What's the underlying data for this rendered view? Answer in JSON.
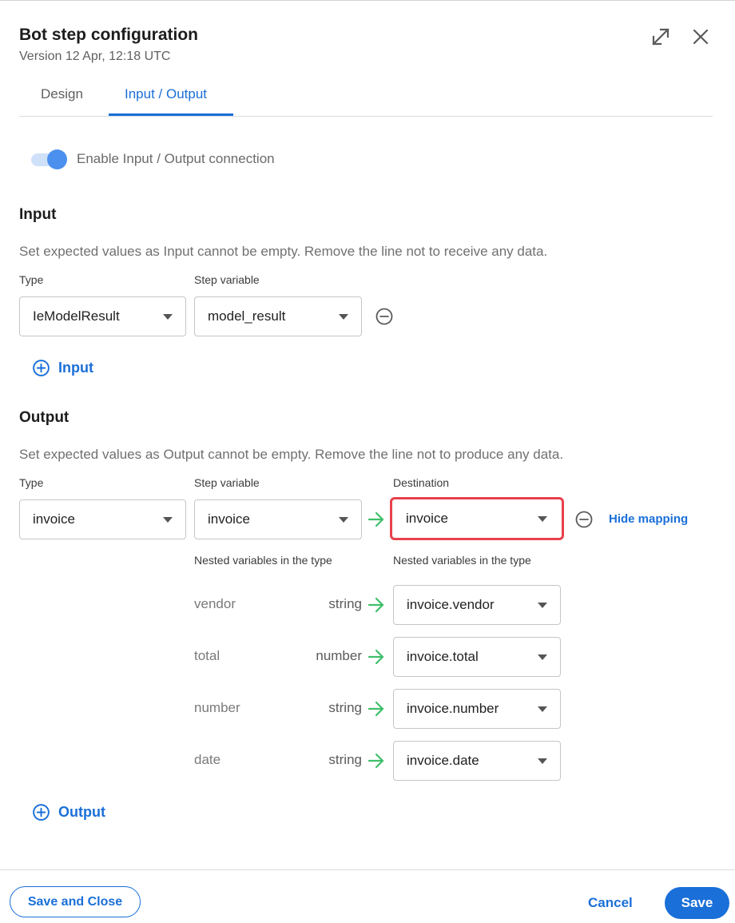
{
  "header": {
    "title": "Bot step configuration",
    "version": "Version 12 Apr, 12:18 UTC"
  },
  "tabs": [
    {
      "label": "Design",
      "active": false
    },
    {
      "label": "Input / Output",
      "active": true
    }
  ],
  "toggle": {
    "label": "Enable Input / Output connection",
    "enabled": true
  },
  "input": {
    "title": "Input",
    "description": "Set expected values as Input cannot be empty. Remove the line not to receive any data.",
    "type_label": "Type",
    "step_variable_label": "Step variable",
    "type_value": "IeModelResult",
    "step_variable_value": "model_result",
    "add_label": "Input"
  },
  "output": {
    "title": "Output",
    "description": "Set expected values as Output cannot be empty. Remove the line not to produce any data.",
    "type_label": "Type",
    "step_variable_label": "Step variable",
    "destination_label": "Destination",
    "type_value": "invoice",
    "step_variable_value": "invoice",
    "destination_value": "invoice",
    "hide_mapping_label": "Hide mapping",
    "nested_label_left": "Nested variables in the type",
    "nested_label_right": "Nested variables in the type",
    "nested": [
      {
        "name": "vendor",
        "type": "string",
        "destination": "invoice.vendor"
      },
      {
        "name": "total",
        "type": "number",
        "destination": "invoice.total"
      },
      {
        "name": "number",
        "type": "string",
        "destination": "invoice.number"
      },
      {
        "name": "date",
        "type": "string",
        "destination": "invoice.date"
      }
    ],
    "add_label": "Output"
  },
  "footer": {
    "save_close_label": "Save and Close",
    "cancel_label": "Cancel",
    "save_label": "Save"
  },
  "colors": {
    "accent": "#1a6fd8",
    "highlight": "#e8414b",
    "arrow": "#3fbf6a"
  },
  "icons": {
    "expand": "expand-icon",
    "close": "close-icon",
    "remove": "minus-circle-icon",
    "add": "plus-circle-icon",
    "arrow": "arrow-right-icon",
    "caret": "caret-down-icon"
  }
}
